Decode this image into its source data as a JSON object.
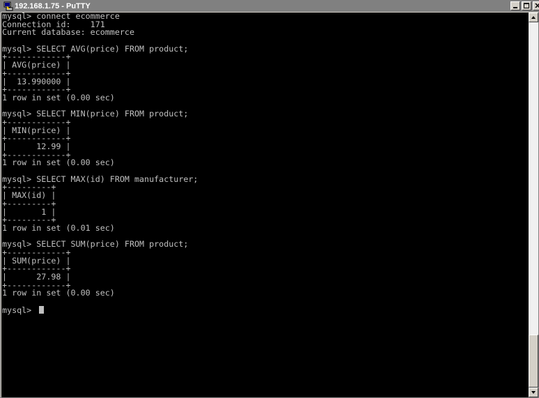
{
  "window": {
    "title": "192.168.1.75 - PuTTY",
    "buttons": {
      "minimize": "minimize",
      "maximize": "maximize",
      "close": "close"
    }
  },
  "terminal": {
    "lines": [
      "mysql> connect ecommerce",
      "Connection id:    171",
      "Current database: ecommerce",
      "",
      "mysql> SELECT AVG(price) FROM product;",
      "+------------+",
      "| AVG(price) |",
      "+------------+",
      "|  13.990000 |",
      "+------------+",
      "1 row in set (0.00 sec)",
      "",
      "mysql> SELECT MIN(price) FROM product;",
      "+------------+",
      "| MIN(price) |",
      "+------------+",
      "|      12.99 |",
      "+------------+",
      "1 row in set (0.00 sec)",
      "",
      "mysql> SELECT MAX(id) FROM manufacturer;",
      "+---------+",
      "| MAX(id) |",
      "+---------+",
      "|       1 |",
      "+---------+",
      "1 row in set (0.01 sec)",
      "",
      "mysql> SELECT SUM(price) FROM product;",
      "+------------+",
      "| SUM(price) |",
      "+------------+",
      "|      27.98 |",
      "+------------+",
      "1 row in set (0.00 sec)",
      "",
      "mysql> "
    ]
  },
  "colors": {
    "terminal_bg": "#000000",
    "terminal_fg": "#c0c0c0",
    "titlebar_bg": "#808080",
    "titlebar_fg": "#ffffff"
  }
}
